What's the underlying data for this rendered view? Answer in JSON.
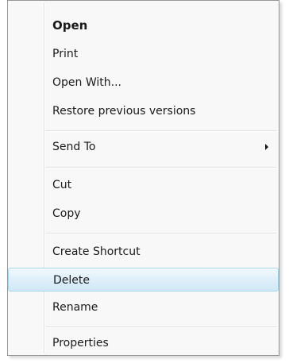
{
  "menu": {
    "items": [
      {
        "label": "Open"
      },
      {
        "label": "Print"
      },
      {
        "label": "Open With..."
      },
      {
        "label": "Restore previous versions"
      },
      {
        "label": "Send To"
      },
      {
        "label": "Cut"
      },
      {
        "label": "Copy"
      },
      {
        "label": "Create Shortcut"
      },
      {
        "label": "Delete"
      },
      {
        "label": "Rename"
      },
      {
        "label": "Properties"
      }
    ]
  },
  "icons": {
    "submenu_arrow": "chevron-right-icon"
  }
}
